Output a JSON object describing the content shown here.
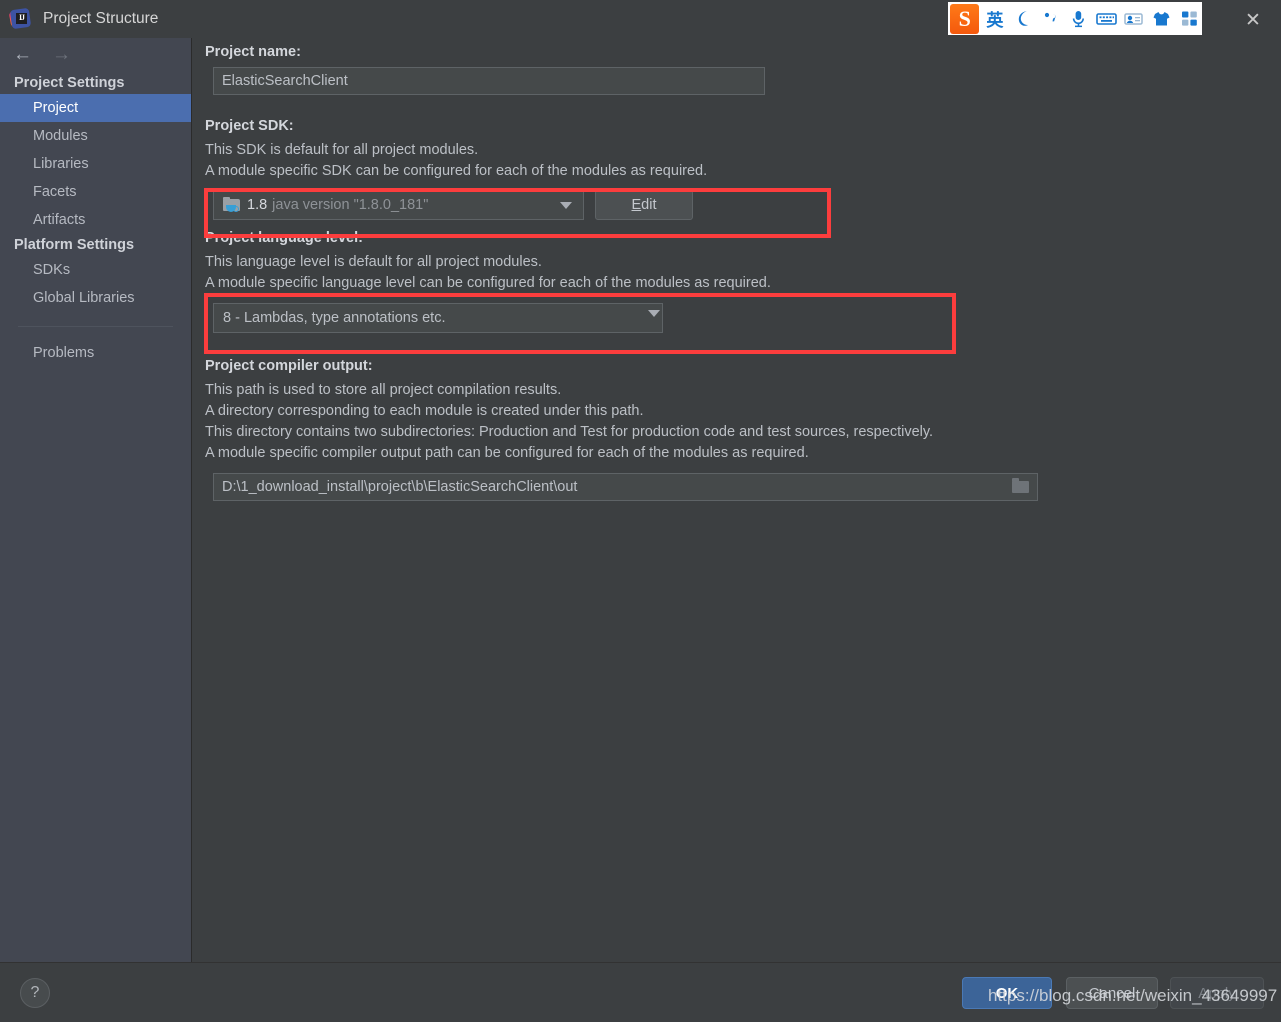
{
  "window": {
    "title": "Project Structure",
    "logo_text": "IJ",
    "close_icon": "✕"
  },
  "ime_toolbar": {
    "logo_label": "S",
    "items": [
      {
        "name": "ime-mode-english",
        "glyph": "英"
      },
      {
        "name": "ime-moon-icon",
        "glyph": "☽"
      },
      {
        "name": "ime-punctuation-icon",
        "glyph": "•,"
      },
      {
        "name": "ime-microphone-icon",
        "glyph": "🎤"
      },
      {
        "name": "ime-keyboard-icon",
        "glyph": "⌨"
      },
      {
        "name": "ime-card-icon",
        "glyph": "🪪"
      },
      {
        "name": "ime-skin-icon",
        "glyph": "👕"
      },
      {
        "name": "ime-apps-icon",
        "glyph": "▦"
      }
    ]
  },
  "sidebar": {
    "back_arrow": "←",
    "forward_arrow": "→",
    "project_settings_header": "Project Settings",
    "project_settings_items": [
      {
        "label": "Project",
        "selected": true
      },
      {
        "label": "Modules",
        "selected": false
      },
      {
        "label": "Libraries",
        "selected": false
      },
      {
        "label": "Facets",
        "selected": false
      },
      {
        "label": "Artifacts",
        "selected": false
      }
    ],
    "platform_settings_header": "Platform Settings",
    "platform_settings_items": [
      {
        "label": "SDKs",
        "selected": false
      },
      {
        "label": "Global Libraries",
        "selected": false
      }
    ],
    "problems_item": "Problems"
  },
  "main": {
    "project_name": {
      "label": "Project name:",
      "value": "ElasticSearchClient"
    },
    "project_sdk": {
      "label": "Project SDK:",
      "desc_line1": "This SDK is default for all project modules.",
      "desc_line2": "A module specific SDK can be configured for each of the modules as required.",
      "selected_name": "1.8",
      "selected_version": "java version \"1.8.0_181\"",
      "edit_button": "Edit",
      "edit_button_mnemonic": "E",
      "edit_button_rest": "dit"
    },
    "language_level": {
      "label": "Project language level:",
      "desc_line1": "This language level is default for all project modules.",
      "desc_line2": "A module specific language level can be configured for each of the modules as required.",
      "selected": "8 - Lambdas, type annotations etc."
    },
    "compiler_output": {
      "label": "Project compiler output:",
      "desc_line1": "This path is used to store all project compilation results.",
      "desc_line2": "A directory corresponding to each module is created under this path.",
      "desc_line3": "This directory contains two subdirectories: Production and Test for production code and test sources, respectively.",
      "desc_line4": "A module specific compiler output path can be configured for each of the modules as required.",
      "value": "D:\\1_download_install\\project\\b\\ElasticSearchClient\\out"
    }
  },
  "footer": {
    "help_label": "?",
    "ok_label": "OK",
    "cancel_label": "Cancel",
    "apply_label": "Apply"
  },
  "watermark": {
    "text": "https://blog.csdn.net/weixin_43649997"
  },
  "annotations": {
    "accent_color": "#fc3d3d",
    "selection_color": "#4b6eaf"
  }
}
